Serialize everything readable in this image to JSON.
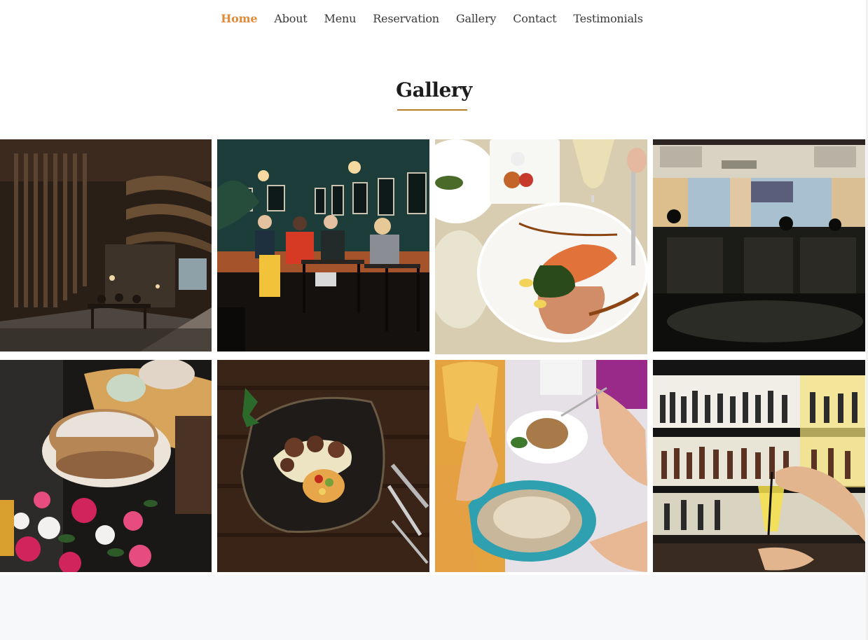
{
  "nav": {
    "items": [
      "Home",
      "About",
      "Menu",
      "Reservation",
      "Gallery",
      "Contact",
      "Testimonials"
    ],
    "active": "Home"
  },
  "gallery": {
    "title": "Gallery",
    "accent_color": "#b87e2c",
    "tiles": [
      {
        "subject": "restaurant-interior-wooden-slats"
      },
      {
        "subject": "cafe-diners-at-table"
      },
      {
        "subject": "salmon-plate-dish"
      },
      {
        "subject": "bright-dining-room"
      },
      {
        "subject": "cake-with-flowers"
      },
      {
        "subject": "plated-dish-dark-table"
      },
      {
        "subject": "table-with-wine-and-dishes"
      },
      {
        "subject": "bar-shelves-with-cocktail"
      }
    ]
  },
  "colors": {
    "nav_active": "#e08a3a",
    "nav_text": "#3a3a3a",
    "footer_bg": "#f7f8fa"
  }
}
